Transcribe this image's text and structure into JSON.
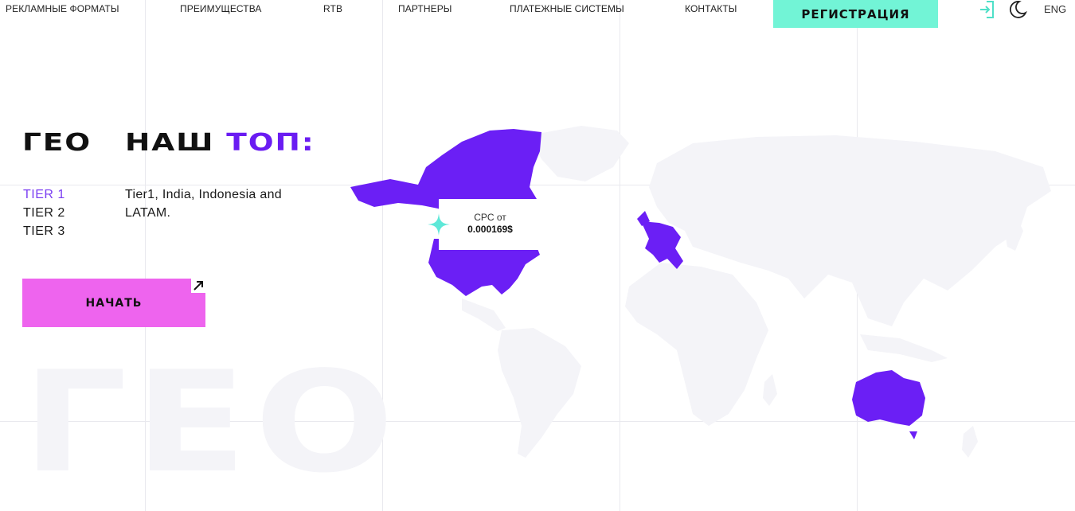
{
  "nav": {
    "items": [
      "РЕКЛАМНЫЕ ФОРМАТЫ",
      "ПРЕИМУЩЕСТВА",
      "RTB",
      "ПАРТНЕРЫ",
      "ПЛАТЕЖНЫЕ СИСТЕМЫ",
      "КОНТАКТЫ"
    ],
    "register_label": "РЕГИСТРАЦИЯ",
    "login_icon": "login-icon",
    "theme_icon": "moon-icon",
    "language": "ENG"
  },
  "geo": {
    "title_left": "ГЕО",
    "title_main": "НАШ",
    "title_accent": "ТОП:",
    "tiers": [
      "TIER 1",
      "TIER 2",
      "TIER 3"
    ],
    "active_tier": "TIER 1",
    "description": "Tier1, India, Indonesia and LATAM.",
    "start_label": "НАЧАТЬ",
    "start_icon": "arrow-up-right-icon",
    "watermark": "ГЕО"
  },
  "tooltip": {
    "label": "CPC от",
    "value": "0.000169$"
  },
  "colors": {
    "accent_purple": "#6a1cf2",
    "highlight_region": "#6b1ff5",
    "register_green": "#72f4d6",
    "start_pink": "#ee64ee",
    "map_land": "#f4f4f8",
    "tier_active": "#7b3ef2",
    "star_cyan": "#5ee8d8"
  }
}
